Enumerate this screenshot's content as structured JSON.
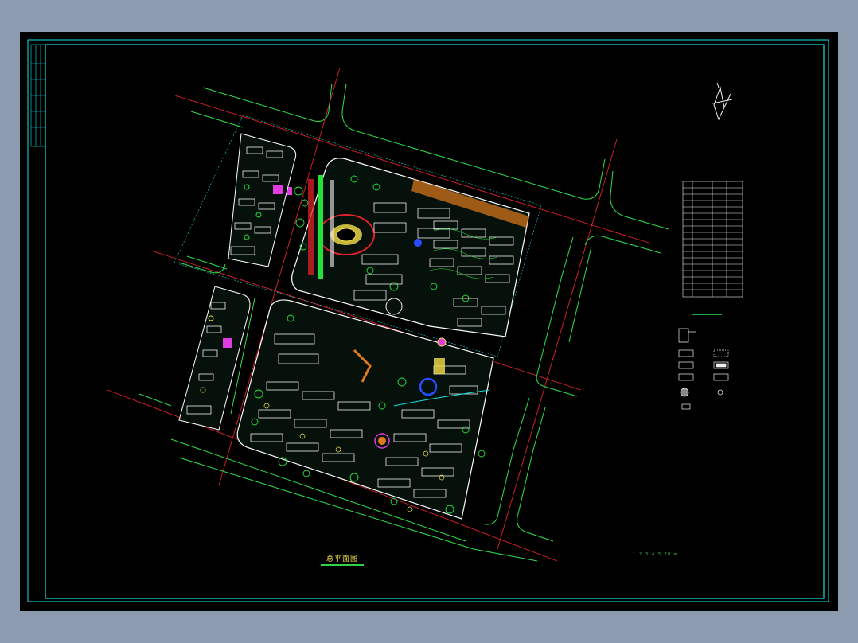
{
  "drawing": {
    "title": "总平面图",
    "scale_text": "1 2 3 4 5 10 m",
    "colors": {
      "background": "#000000",
      "frame": "#14e0e0",
      "road_red": "#e0202a",
      "road_edge": "#2ee04a",
      "block_outline": "#ffffff",
      "building": "#f0f0f0",
      "tree": "#22e23a",
      "accent_yellow": "#f5e04a",
      "accent_magenta": "#e03ce0",
      "accent_orange": "#e07a1e",
      "accent_blue": "#2a4cff"
    }
  },
  "icons": {
    "north_arrow": "north-arrow-icon",
    "legend_symbols": "legend-symbol-icons"
  }
}
